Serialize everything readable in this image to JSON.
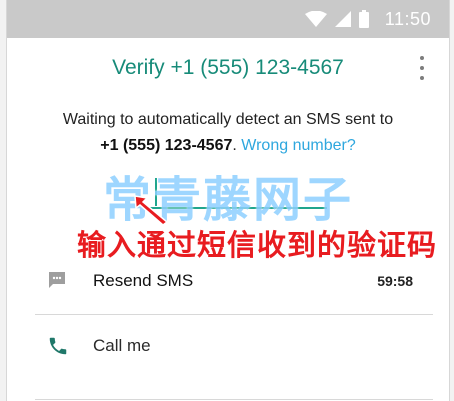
{
  "status_bar": {
    "time": "11:50",
    "icons": [
      "wifi-icon",
      "signal-icon",
      "battery-icon"
    ]
  },
  "header": {
    "title": "Verify +1 (555) 123-4567",
    "menu_icon": "overflow-menu-icon"
  },
  "description": {
    "line1": "Waiting to automatically detect an SMS sent to",
    "phone": "+1 (555) 123-4567",
    "punct": ".",
    "wrong_number": "Wrong number?"
  },
  "code_input": {
    "value": ""
  },
  "overlay": {
    "watermark": "常青藤网子",
    "callout": "输入通过短信收到的验证码"
  },
  "actions": {
    "resend": {
      "label": "Resend SMS",
      "timer": "59:58",
      "icon": "message-icon"
    },
    "call": {
      "label": "Call me",
      "icon": "phone-icon"
    }
  },
  "colors": {
    "accent": "#178b79",
    "link": "#2ea7de",
    "callout": "#e81c20",
    "watermark": "#8ed0ff"
  }
}
